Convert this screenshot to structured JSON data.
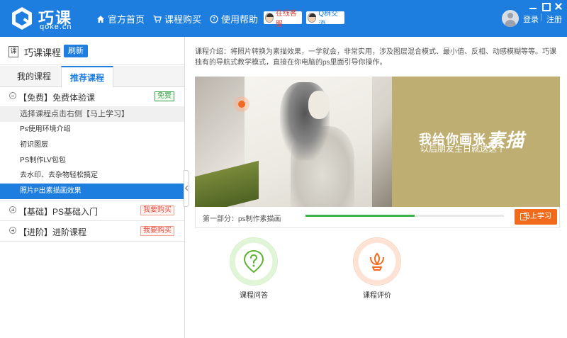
{
  "header": {
    "logo_cn": "巧课",
    "logo_en": "qoke.cn",
    "nav": {
      "home": "官方首页",
      "buy": "课程购买",
      "help": "使用帮助"
    },
    "service_label": "在线客服",
    "qq_label": "Q群交流",
    "login": "登录",
    "separator": "|",
    "register": "注册"
  },
  "sidebar": {
    "icon_char": "课",
    "title": "巧课课程",
    "refresh": "刷新",
    "tabs": [
      "我的课程",
      "推荐课程"
    ],
    "sections": [
      {
        "label": "【免费】免费体验课",
        "badge": "免费",
        "hint": "选择课程点击右侧【马上学习】",
        "lessons": [
          "Ps使用环境介绍",
          "初识图层",
          "PS制作LV包包",
          "去水印、去杂物轻松搞定",
          "照片P出素描画效果"
        ]
      },
      {
        "label": "【基础】PS基础入门",
        "badge": "我要购买"
      },
      {
        "label": "【进阶】进阶课程",
        "badge": "我要购买"
      }
    ]
  },
  "main": {
    "intro": "课程介绍：将照片转换为素描效果，一学就会，非常实用，涉及图层混合模式、最小值、反相、动感模糊等等。巧课独有的导航式教学模式，直接在你电脑的ps里面引导你操作。",
    "banner": {
      "headline": "我给你画张",
      "headline_calli": "素描",
      "subline": "以后朋友生日就送这个"
    },
    "part_label": "第一部分：ps制作素描画",
    "progress": 0.55,
    "learn_button": "马上学习",
    "features": [
      {
        "label": "课程问答",
        "icon": "question-icon"
      },
      {
        "label": "课程评价",
        "icon": "lotus-icon"
      }
    ]
  },
  "colors": {
    "brand": "#1d7ee0",
    "accent": "#f26a1b",
    "green": "#3bb14a"
  }
}
